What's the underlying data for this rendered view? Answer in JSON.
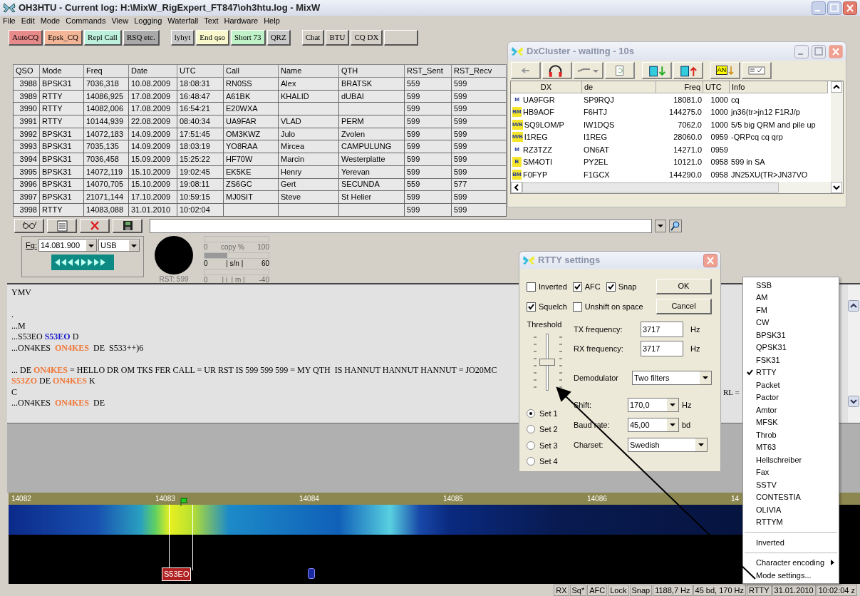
{
  "window": {
    "title": "OH3HTU - Current log: H:\\MixW_RigExpert_FT847\\oh3htu.log - MixW"
  },
  "menu": [
    "File",
    "Edit",
    "Mode",
    "Commands",
    "View",
    "Logging",
    "Waterfall",
    "Text",
    "Hardware",
    "Help"
  ],
  "macro_buttons": [
    {
      "label": "AutoCQ",
      "color": "#e78a8a"
    },
    {
      "label": "Epsk_CQ",
      "color": "#f2b596"
    },
    {
      "label": "Repl Call",
      "color": "#bdf0dc"
    },
    {
      "label": "RSQ etc.",
      "color": "#a9a9a9"
    },
    {
      "label": "lyhyt",
      "color": "#c9c9c9"
    },
    {
      "label": "End qso",
      "color": "#f8f8cc"
    },
    {
      "label": "Short 73",
      "color": "#bff2c8"
    },
    {
      "label": "QRZ",
      "color": "#c9c9c9"
    },
    {
      "label": "Chat",
      "color": "#d4d0c8"
    },
    {
      "label": "BTU",
      "color": "#d4d0c8"
    },
    {
      "label": "CQ DX",
      "color": "#d4d0c8"
    }
  ],
  "log_table": {
    "columns": [
      "QSO",
      "Mode",
      "Freq",
      "Date",
      "UTC",
      "Call",
      "Name",
      "QTH",
      "RST_Sent",
      "RST_Recv"
    ],
    "rows": [
      [
        "3988",
        "BPSK31",
        "7036,318",
        "10.08.2009",
        "18:08:31",
        "RN0SS",
        "Alex",
        "BRATSK",
        "559",
        "599"
      ],
      [
        "3989",
        "RTTY",
        "14086,925",
        "17.08.2009",
        "16:48:47",
        "A61BK",
        "KHALID",
        "dUBAI",
        "599",
        "599"
      ],
      [
        "3990",
        "RTTY",
        "14082,006",
        "17.08.2009",
        "16:54:21",
        "E20WXA",
        "",
        "",
        "599",
        "599"
      ],
      [
        "3991",
        "RTTY",
        "10144,939",
        "22.08.2009",
        "08:40:34",
        "UA9FAR",
        "VLAD",
        "PERM",
        "599",
        "599"
      ],
      [
        "3992",
        "BPSK31",
        "14072,183",
        "14.09.2009",
        "17:51:45",
        "OM3KWZ",
        "Julo",
        "Zvolen",
        "599",
        "599"
      ],
      [
        "3993",
        "BPSK31",
        "7035,135",
        "14.09.2009",
        "18:03:19",
        "YO8RAA",
        "Mircea",
        "CAMPULUNG",
        "599",
        "599"
      ],
      [
        "3994",
        "BPSK31",
        "7036,458",
        "15.09.2009",
        "15:25:22",
        "HF70W",
        "Marcin",
        "Westerplatte",
        "599",
        "599"
      ],
      [
        "3995",
        "BPSK31",
        "14072,119",
        "15.10.2009",
        "19:02:45",
        "EK5KE",
        "Henry",
        "Yerevan",
        "599",
        "599"
      ],
      [
        "3996",
        "BPSK31",
        "14070,705",
        "15.10.2009",
        "19:08:11",
        "ZS6GC",
        "Gert",
        "SECUNDA",
        "559",
        "577"
      ],
      [
        "3997",
        "BPSK31",
        "21071,144",
        "17.10.2009",
        "10:59:15",
        "MJ0SIT",
        "Steve",
        "St Helier",
        "599",
        "599"
      ],
      [
        "3998",
        "RTTY",
        "14083,088",
        "31.01.2010",
        "10:02:04",
        "",
        "",
        "",
        "599",
        "599"
      ]
    ]
  },
  "dx_cluster": {
    "title": "DxCluster - waiting - 10s",
    "filter_label": "AN",
    "columns": [
      "DX",
      "de",
      "Freq",
      "UTC",
      "Info"
    ],
    "rows": [
      {
        "badge": "M",
        "cells": [
          "UA9FGR",
          "SP9RQJ",
          "18081.0",
          "1000",
          "cq"
        ]
      },
      {
        "badge": "BM",
        "cells": [
          "HB9AOF",
          "F6HTJ",
          "144275.0",
          "1000",
          "jn36(tr>jn12 F1RJ/p"
        ]
      },
      {
        "badge": "M/B",
        "cells": [
          "SQ9LOM/P",
          "IW1DQS",
          "7062.0",
          "1000",
          "5/5 big QRM and pile up"
        ]
      },
      {
        "badge": "M/B",
        "cells": [
          "I1REG",
          "I1REG",
          "28060.0",
          "0959",
          "-QRPcq cq qrp"
        ]
      },
      {
        "badge": "M",
        "cells": [
          "RZ3TZZ",
          "ON6AT",
          "14271.0",
          "0959",
          ""
        ]
      },
      {
        "badge": "B",
        "cells": [
          "SM4OTI",
          "PY2EL",
          "10121.0",
          "0958",
          "599 in SA"
        ]
      },
      {
        "badge": "BM",
        "cells": [
          "F0FYP",
          "F1GCX",
          "144290.0",
          "0958",
          "JN25XU(TR>JN37VO"
        ]
      }
    ]
  },
  "radio": {
    "fq_label": "Fq:",
    "frequency": "14.081.900",
    "sideband": "USB"
  },
  "meters": [
    {
      "level": 0,
      "labels": [
        "0",
        "copy %",
        "100"
      ]
    },
    {
      "level": 0.35,
      "labels": [
        "0",
        "| s/n |",
        "60"
      ]
    },
    {
      "level": 0,
      "labels": [
        "0",
        "| i  | m |",
        "-40"
      ]
    }
  ],
  "rst": "RST: 599",
  "receive_text": [
    {
      "space_before": false,
      "segments": [
        {
          "text": "YMV"
        }
      ]
    },
    {
      "space_before": true,
      "segments": [
        {
          "text": "."
        }
      ]
    },
    {
      "space_before": false,
      "segments": [
        {
          "text": "...M"
        }
      ]
    },
    {
      "space_before": false,
      "segments": [
        {
          "text": "...S53EO "
        },
        {
          "text": "S53EO",
          "color": "#1a1acc"
        },
        {
          "text": " D"
        }
      ]
    },
    {
      "space_before": false,
      "segments": [
        {
          "text": "...ON4KES  "
        },
        {
          "text": "ON4KES",
          "color": "#f07838"
        },
        {
          "text": "  DE  S533++)6"
        }
      ]
    },
    {
      "space_before": true,
      "segments": [
        {
          "text": "... DE "
        },
        {
          "text": "ON4KES",
          "color": "#f07838"
        },
        {
          "text": " = HELLO DR OM TKS FER CALL = UR RST IS 599 599 599 = MY QTH  IS HANNUT HANNUT HANNUT = JO20MC"
        }
      ]
    },
    {
      "space_before": false,
      "segments": [
        {
          "text": "S53ZO",
          "color": "#f07838"
        },
        {
          "text": " DE "
        },
        {
          "text": "ON4KES",
          "color": "#f07838"
        },
        {
          "text": " K"
        }
      ]
    },
    {
      "space_before": false,
      "segments": [
        {
          "text": "C"
        }
      ]
    },
    {
      "space_before": false,
      "segments": [
        {
          "text": "...ON4KES  "
        },
        {
          "text": "ON4KES",
          "color": "#f07838"
        },
        {
          "text": "  DE"
        }
      ]
    }
  ],
  "receive_text_tail": "RL =",
  "waterfall": {
    "ticks": [
      "14082",
      "14083",
      "14084",
      "14085",
      "14086",
      "14"
    ],
    "marker": "S53EO"
  },
  "status_bar": [
    "RX",
    "Sq*",
    "AFC",
    "Lock",
    "Snap",
    "1188,7 Hz",
    "45 bd, 170 Hz",
    "RTTY",
    "31.01.2010",
    "10:02:04 z"
  ],
  "rtty_dialog": {
    "title": "RTTY settings",
    "checkboxes": [
      {
        "label": "Inverted",
        "checked": false
      },
      {
        "label": "AFC",
        "checked": true
      },
      {
        "label": "Snap",
        "checked": true
      },
      {
        "label": "Squelch",
        "checked": true
      },
      {
        "label": "Unshift on space",
        "checked": false
      }
    ],
    "buttons": [
      "OK",
      "Cancel"
    ],
    "threshold": {
      "label": "Threshold",
      "level": 0.5
    },
    "fields": [
      {
        "label": "TX frequency:",
        "value": "3717",
        "unit": "Hz"
      },
      {
        "label": "RX frequency:",
        "value": "3717",
        "unit": "Hz"
      }
    ],
    "demodulator": {
      "label": "Demodulator",
      "value": "Two filters"
    },
    "dropdowns": [
      {
        "label": "Shift:",
        "value": "170,0",
        "unit": "Hz"
      },
      {
        "label": "Baud rate:",
        "value": "45,00",
        "unit": "bd"
      },
      {
        "label": "Charset:",
        "value": "Swedish"
      }
    ],
    "sets": [
      {
        "label": "Set 1",
        "selected": true
      },
      {
        "label": "Set 2",
        "selected": false
      },
      {
        "label": "Set 3",
        "selected": false
      },
      {
        "label": "Set 4",
        "selected": false
      }
    ]
  },
  "mode_menu": [
    {
      "kind": "item",
      "label": "SSB",
      "checked": false
    },
    {
      "kind": "item",
      "label": "AM",
      "checked": false
    },
    {
      "kind": "item",
      "label": "FM",
      "checked": false
    },
    {
      "kind": "item",
      "label": "CW",
      "checked": false
    },
    {
      "kind": "item",
      "label": "BPSK31",
      "checked": false
    },
    {
      "kind": "item",
      "label": "QPSK31",
      "checked": false
    },
    {
      "kind": "item",
      "label": "FSK31",
      "checked": false
    },
    {
      "kind": "item",
      "label": "RTTY",
      "checked": true
    },
    {
      "kind": "item",
      "label": "Packet",
      "checked": false
    },
    {
      "kind": "item",
      "label": "Pactor",
      "checked": false
    },
    {
      "kind": "item",
      "label": "Amtor",
      "checked": false
    },
    {
      "kind": "item",
      "label": "MFSK",
      "checked": false
    },
    {
      "kind": "item",
      "label": "Throb",
      "checked": false
    },
    {
      "kind": "item",
      "label": "MT63",
      "checked": false
    },
    {
      "kind": "item",
      "label": "Hellschreiber",
      "checked": false
    },
    {
      "kind": "item",
      "label": "Fax",
      "checked": false
    },
    {
      "kind": "item",
      "label": "SSTV",
      "checked": false
    },
    {
      "kind": "item",
      "label": "CONTESTIA",
      "checked": false
    },
    {
      "kind": "item",
      "label": "OLIVIA",
      "checked": false
    },
    {
      "kind": "item",
      "label": "RTTYM",
      "checked": false
    },
    {
      "kind": "separator"
    },
    {
      "kind": "item",
      "label": "Inverted",
      "checked": false
    },
    {
      "kind": "separator"
    },
    {
      "kind": "submenu",
      "label": "Character encoding"
    },
    {
      "kind": "item",
      "label": "Mode settings...",
      "checked": false
    }
  ]
}
